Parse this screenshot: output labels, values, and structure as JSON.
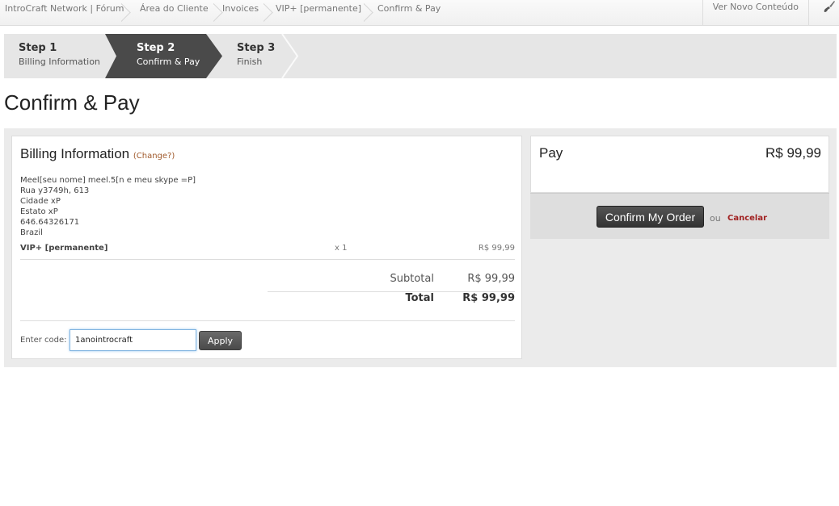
{
  "breadcrumbs": [
    "IntroCraft Network | Fórum",
    "Área do Cliente",
    "Invoices",
    "VIP+ [permanente]",
    "Confirm & Pay"
  ],
  "top_right": {
    "new_content_label": "Ver Novo Conteúdo",
    "icon": "brush-icon"
  },
  "steps": [
    {
      "title": "Step 1",
      "subtitle": "Billing Information",
      "active": false
    },
    {
      "title": "Step 2",
      "subtitle": "Confirm & Pay",
      "active": true
    },
    {
      "title": "Step 3",
      "subtitle": "Finish",
      "active": false
    }
  ],
  "page_title": "Confirm & Pay",
  "billing": {
    "title": "Billing Information",
    "change_label": "(Change?)",
    "address_lines": [
      "Meel[seu nome] meel.5[n e meu skype =P]",
      "Rua y3749h, 613",
      "Cidade xP",
      "Estato xP",
      "646.64326171",
      "Brazil"
    ],
    "item": {
      "name": "VIP+ [permanente]",
      "qty": "x 1",
      "price": "R$ 99,99"
    },
    "subtotal_label": "Subtotal",
    "subtotal_value": "R$ 99,99",
    "total_label": "Total",
    "total_value": "R$ 99,99",
    "code_label": "Enter code:",
    "code_value": "1anointrocraft",
    "apply_label": "Apply"
  },
  "pay": {
    "label": "Pay",
    "amount": "R$ 99,99",
    "confirm_label": "Confirm My Order",
    "or_label": "ou",
    "cancel_label": "Cancelar"
  },
  "colors": {
    "accent_link": "#a05a2c",
    "cancel": "#a02020",
    "active_step": "#4a4a4a"
  }
}
